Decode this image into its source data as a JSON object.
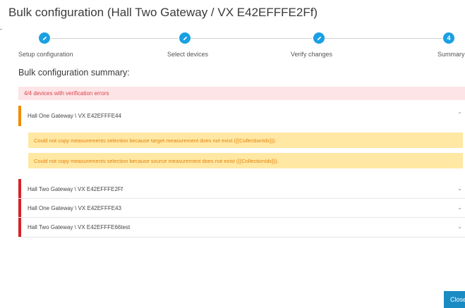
{
  "dialog": {
    "title": "Bulk configuration (Hall Two Gateway / VX E42EFFFE2Ff)"
  },
  "stepper": {
    "steps": [
      {
        "label": "Setup configuration",
        "marker": "pencil-icon",
        "state": "completed"
      },
      {
        "label": "Select devices",
        "marker": "pencil-icon",
        "state": "completed"
      },
      {
        "label": "Verify changes",
        "marker": "pencil-icon",
        "state": "completed"
      },
      {
        "label": "Summary",
        "marker": "4",
        "state": "active"
      }
    ]
  },
  "summary": {
    "heading": "Bulk configuration summary:",
    "banner": "4/4 devices with verification errors",
    "devices": [
      {
        "name": "Hall One Gateway \\ VX E42EFFFE44",
        "status": "warning",
        "expanded": true,
        "messages": [
          "Could not copy measurements selection because target measurement does not exist ({{CollectionIds}}).",
          "Could not copy measurements selection because source measurement does not exist ({{CollectionIds}})."
        ]
      },
      {
        "name": "Hall Two Gateway \\ VX E42EFFFE2Ff",
        "status": "error",
        "expanded": false
      },
      {
        "name": "Hall One Gateway \\ VX E42EFFFE43",
        "status": "error",
        "expanded": false
      },
      {
        "name": "Hall Two Gateway \\ VX E42EFFFE66test",
        "status": "error",
        "expanded": false
      }
    ]
  },
  "footer": {
    "close_label": "Close"
  },
  "colors": {
    "accent": "#1aa0e3",
    "warning_stripe": "#f08c00",
    "error_stripe": "#d8232a",
    "error_banner_bg": "#fde4e6",
    "warning_bg": "#ffe8a3"
  }
}
